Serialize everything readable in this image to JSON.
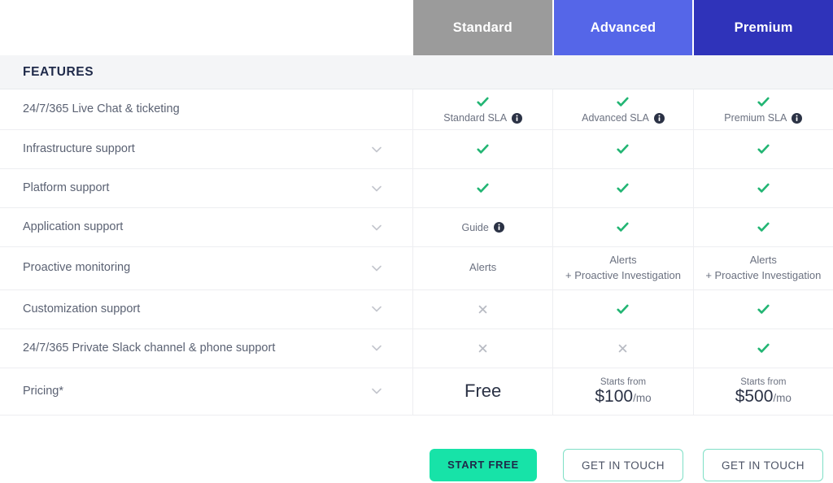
{
  "plans": [
    {
      "name": "Standard",
      "color": "#9b9b9b"
    },
    {
      "name": "Advanced",
      "color": "#5566e8"
    },
    {
      "name": "Premium",
      "color": "#2f33ba"
    }
  ],
  "section": {
    "title": "FEATURES"
  },
  "icons": {
    "check": "check-icon",
    "cross": "cross-icon",
    "info": "info-icon",
    "chevron": "chevron-down-icon"
  },
  "rows": [
    {
      "label": "24/7/365 Live Chat & ticketing",
      "has_chevron": false,
      "cells": [
        {
          "type": "check-with-note",
          "note": "Standard SLA",
          "info": true
        },
        {
          "type": "check-with-note",
          "note": "Advanced SLA",
          "info": true
        },
        {
          "type": "check-with-note",
          "note": "Premium SLA",
          "info": true
        }
      ]
    },
    {
      "label": "Infrastructure support",
      "has_chevron": true,
      "cells": [
        {
          "type": "check"
        },
        {
          "type": "check"
        },
        {
          "type": "check"
        }
      ]
    },
    {
      "label": "Platform support",
      "has_chevron": true,
      "cells": [
        {
          "type": "check"
        },
        {
          "type": "check"
        },
        {
          "type": "check"
        }
      ]
    },
    {
      "label": "Application support",
      "has_chevron": true,
      "cells": [
        {
          "type": "text-with-info",
          "text": "Guide",
          "info": true
        },
        {
          "type": "check"
        },
        {
          "type": "check"
        }
      ]
    },
    {
      "label": "Proactive monitoring",
      "has_chevron": true,
      "cells": [
        {
          "type": "text",
          "line1": "Alerts"
        },
        {
          "type": "text",
          "line1": "Alerts",
          "line2": "+ Proactive Investigation"
        },
        {
          "type": "text",
          "line1": "Alerts",
          "line2": "+ Proactive Investigation"
        }
      ]
    },
    {
      "label": "Customization support",
      "has_chevron": true,
      "cells": [
        {
          "type": "cross"
        },
        {
          "type": "check"
        },
        {
          "type": "check"
        }
      ]
    },
    {
      "label": "24/7/365 Private Slack channel & phone support",
      "has_chevron": true,
      "cells": [
        {
          "type": "cross"
        },
        {
          "type": "cross"
        },
        {
          "type": "check"
        }
      ]
    },
    {
      "label": "Pricing*",
      "has_chevron": true,
      "is_pricing": true,
      "cells": [
        {
          "type": "price-free",
          "amount": "Free"
        },
        {
          "type": "price",
          "from": "Starts from",
          "amount": "$100",
          "per": "/mo"
        },
        {
          "type": "price",
          "from": "Starts from",
          "amount": "$500",
          "per": "/mo"
        }
      ]
    }
  ],
  "cta": [
    {
      "label": "START FREE",
      "style": "primary"
    },
    {
      "label": "GET IN TOUCH",
      "style": "outline"
    },
    {
      "label": "GET IN TOUCH",
      "style": "outline"
    }
  ],
  "colors": {
    "check_green": "#22b573",
    "cross_gray": "#b9bcc4",
    "info_dark": "#2b3245",
    "accent_mint": "#17e3a8",
    "outline_mint": "#7fdfc6",
    "navy_text": "#1f2a4a"
  }
}
